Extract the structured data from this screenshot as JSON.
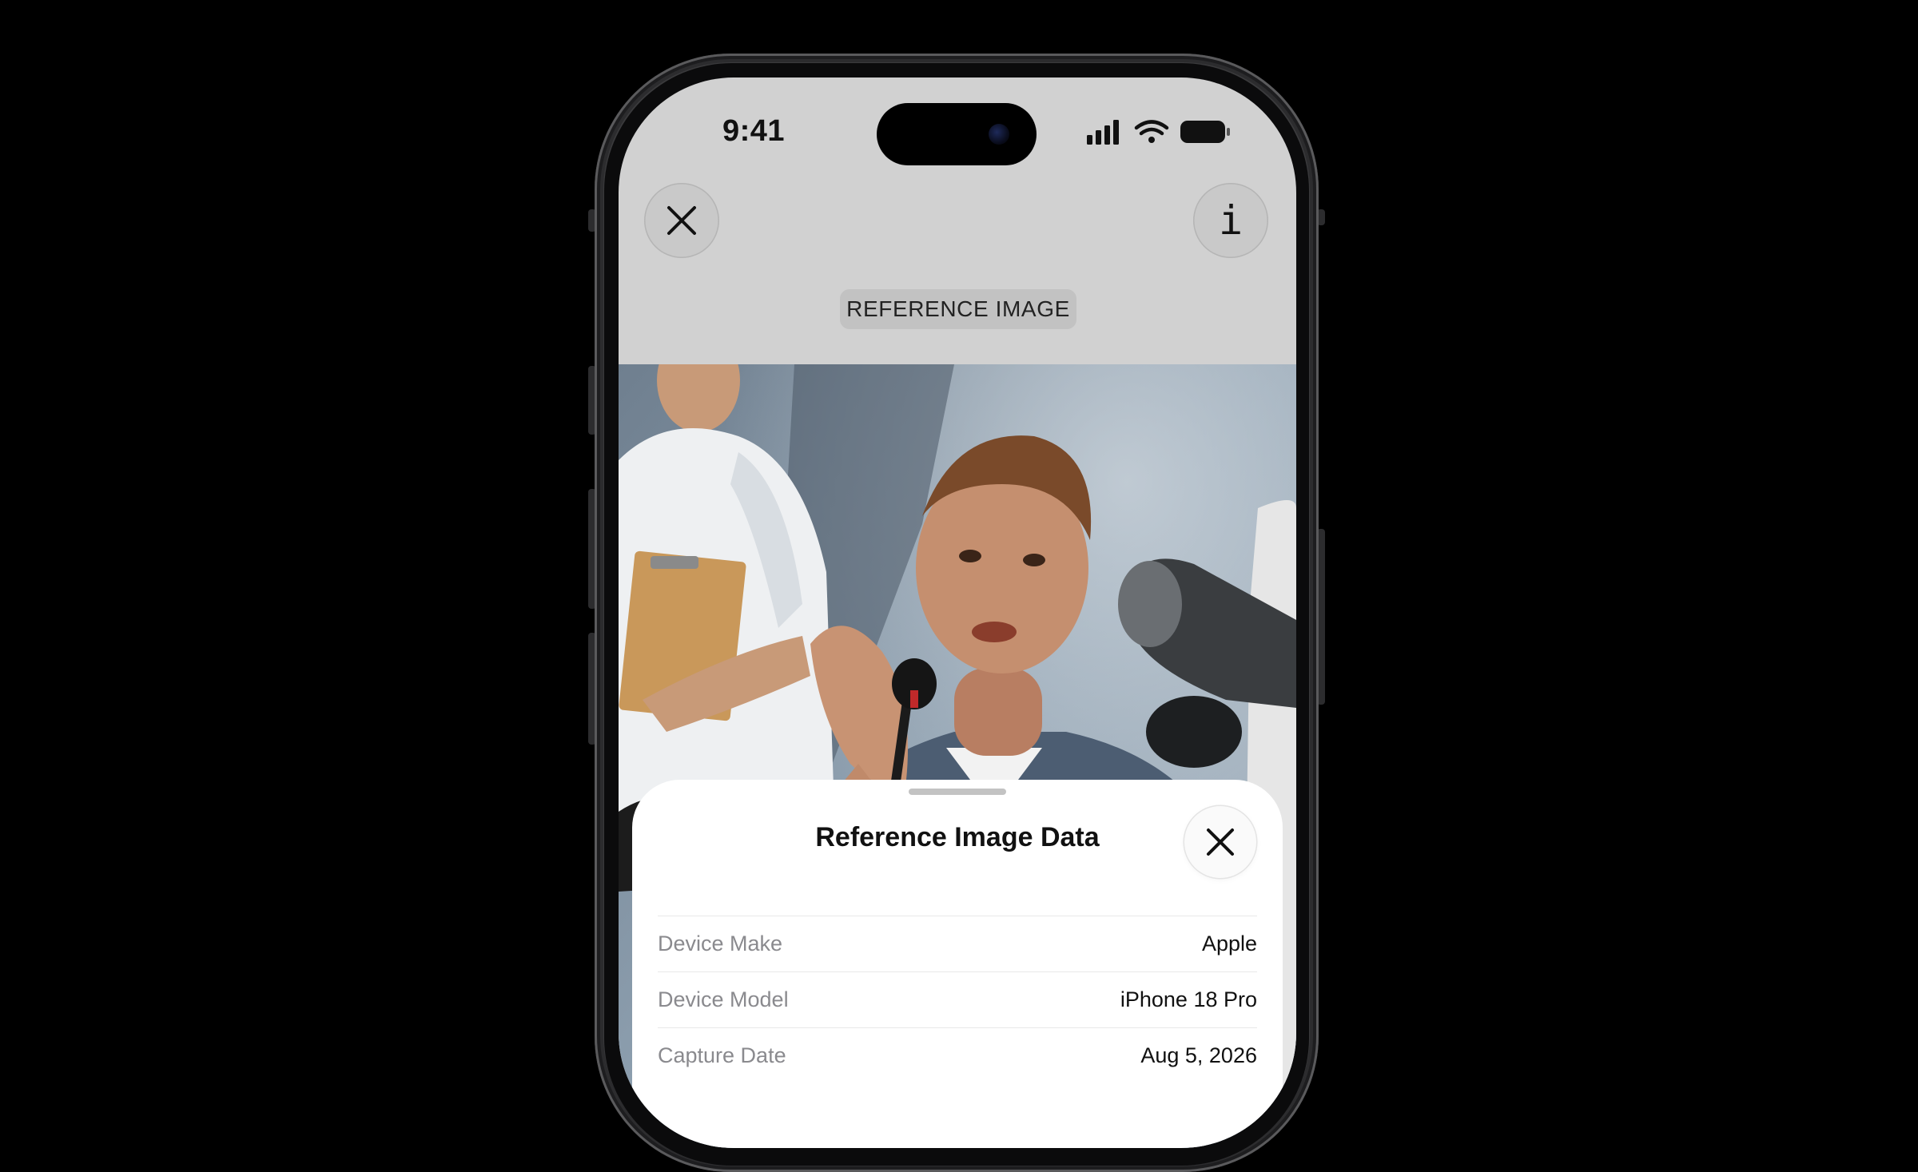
{
  "status_bar": {
    "time": "9:41",
    "icons": [
      "cellular-signal-icon",
      "wifi-icon",
      "battery-icon"
    ]
  },
  "top_bar": {
    "close_icon": "close-icon",
    "info_icon": "info-icon",
    "info_glyph": "i"
  },
  "reference_label": "REFERENCE IMAGE",
  "photo_description_icon": "photo",
  "sheet": {
    "title": "Reference Image Data",
    "close_icon": "close-icon",
    "rows": [
      {
        "label": "Device Make",
        "value": "Apple"
      },
      {
        "label": "Device Model",
        "value": "iPhone 18 Pro"
      },
      {
        "label": "Capture Date",
        "value": "Aug 5, 2026"
      }
    ]
  },
  "colors": {
    "background": "#000000",
    "screen_header": "#d1d1d1",
    "sheet": "#ffffff",
    "label_gray": "#8a8a8e"
  }
}
